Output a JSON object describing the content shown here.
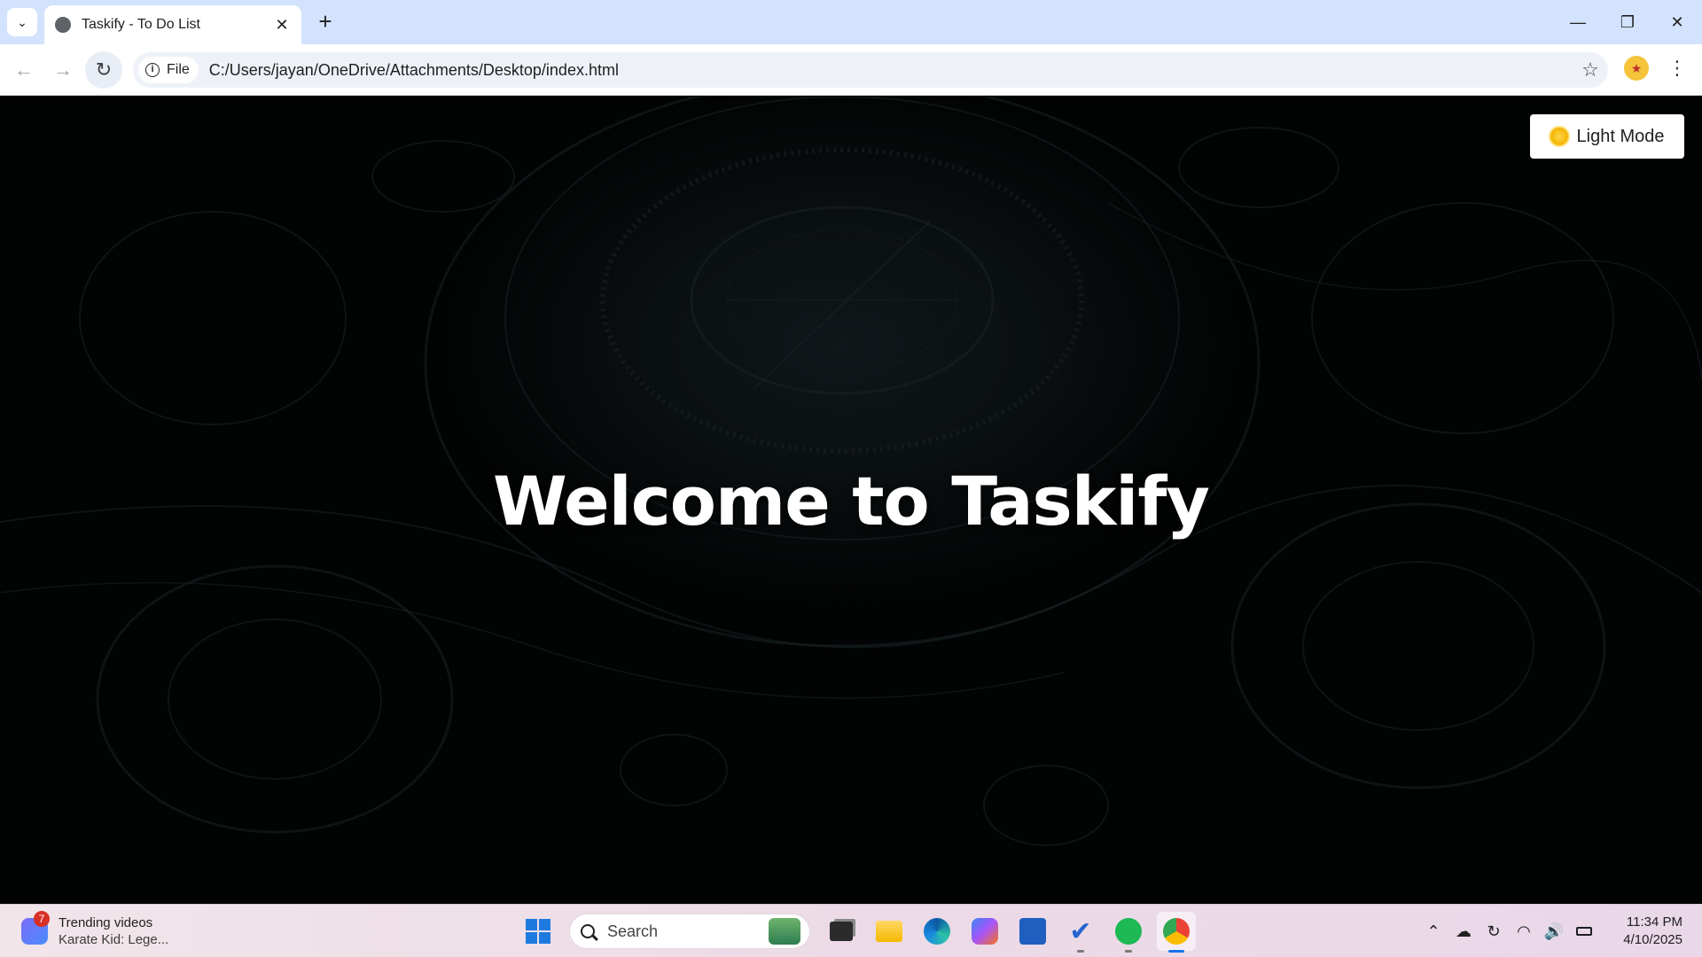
{
  "browser": {
    "tab_title": "Taskify - To Do List",
    "file_label": "File",
    "url": "C:/Users/jayan/OneDrive/Attachments/Desktop/index.html"
  },
  "page": {
    "heading": "Welcome to Taskify",
    "mode_button_label": "Light Mode"
  },
  "taskbar": {
    "widget_badge": "7",
    "widget_title": "Trending videos",
    "widget_subtitle": "Karate Kid: Lege...",
    "search_placeholder": "Search",
    "time": "11:34 PM",
    "date": "4/10/2025"
  },
  "icons": {
    "tab_search": "chevron-down-icon",
    "tab_favicon": "globe-icon",
    "close": "close-icon",
    "new_tab": "plus-icon",
    "back": "arrow-left-icon",
    "forward": "arrow-right-icon",
    "reload": "reload-icon",
    "info": "info-icon",
    "bookmark": "star-icon",
    "menu": "kebab-menu-icon",
    "theme": "sun-icon"
  },
  "colors": {
    "tabbar_bg": "#d3e3fd",
    "page_bg": "#050708",
    "heading": "#ffffff",
    "button_bg": "#ffffff",
    "taskbar_bg": "#eee1e9"
  }
}
